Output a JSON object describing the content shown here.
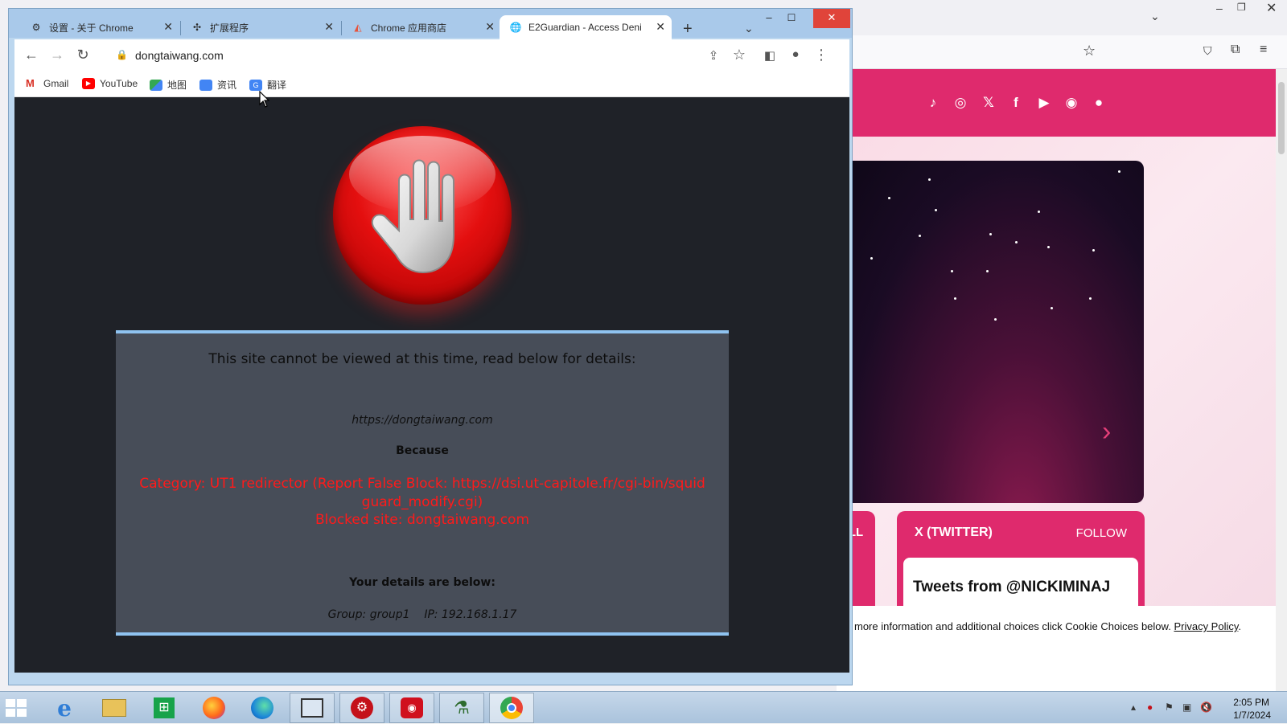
{
  "chrome": {
    "tabs": [
      {
        "title": "设置 - 关于 Chrome",
        "icon": "gear-icon"
      },
      {
        "title": "扩展程序",
        "icon": "puzzle-icon"
      },
      {
        "title": "Chrome 应用商店",
        "icon": "webstore-icon"
      },
      {
        "title": "E2Guardian - Access Deni",
        "icon": "globe-icon",
        "active": true
      }
    ],
    "url": "dongtaiwang.com",
    "bookmarks": [
      {
        "label": "Gmail",
        "icon": "gmail-icon"
      },
      {
        "label": "YouTube",
        "icon": "youtube-icon"
      },
      {
        "label": "地图",
        "icon": "maps-icon"
      },
      {
        "label": "资讯",
        "icon": "news-icon"
      },
      {
        "label": "翻译",
        "icon": "translate-icon"
      }
    ]
  },
  "block_page": {
    "heading": "This site cannot be viewed at this time, read below for details:",
    "blocked_url": "https://dongtaiwang.com",
    "because_label": "Because",
    "category_line1": "Category: UT1 redirector (Report False Block: https://dsi.ut-capitole.fr/cgi-bin/squid",
    "category_line2": "guard_modify.cgi)",
    "blocked_site": "Blocked site: dongtaiwang.com",
    "details_label": "Your details are below:",
    "group": "Group: group1",
    "ip": "IP: 192.168.1.17"
  },
  "background_site": {
    "social_icons": [
      "tiktok-icon",
      "instagram-icon",
      "x-icon",
      "facebook-icon",
      "youtube-icon",
      "spotify-icon",
      "apple-icon"
    ],
    "left_tab_label": "ALL",
    "twitter_title": "X (TWITTER)",
    "follow_label": "FOLLOW",
    "tweets_heading": "Tweets from @NICKIMINAJ",
    "cookie_text": "more information and additional choices click Cookie Choices below.",
    "cookie_link": "Privacy Policy",
    "cookie_trail": ".",
    "accent_color": "#df2a6d"
  },
  "taskbar": {
    "apps": [
      "start-icon",
      "ie-icon",
      "file-explorer-icon",
      "store-icon",
      "firefox-icon",
      "edge-icon",
      "remote-desktop-icon",
      "app-red-icon",
      "recorder-icon",
      "tool-icon",
      "chrome-icon"
    ],
    "time": "2:05 PM",
    "date": "1/7/2024"
  }
}
